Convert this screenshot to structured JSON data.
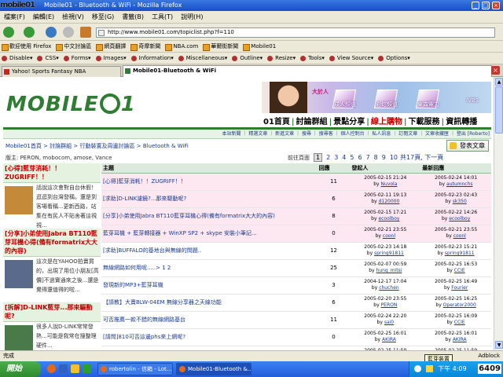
{
  "window": {
    "title": "Mobile01 - Bluetooth & WiFi - Mozilla Firefox",
    "overlay_logo": "mobile01"
  },
  "menu": [
    "檔案(F)",
    "編輯(E)",
    "檢視(V)",
    "移至(G)",
    "書籤(B)",
    "工具(T)",
    "說明(H)"
  ],
  "nav": {
    "url": "http://www.mobile01.com/topiclist.php?f=110"
  },
  "bookmarks": [
    "歡迎使用 Firefox",
    "中文討論區",
    "網頁翻譯",
    "奇摩新聞",
    "NBA.com",
    "華爾街新聞",
    "Mobile01"
  ],
  "devbar": [
    "Disable▾",
    "CSS▾",
    "Forms▾",
    "Images▾",
    "Information▾",
    "Miscellaneous▾",
    "Outline▾",
    "Resize▾",
    "Tools▾",
    "View Source▾",
    "Options▾"
  ],
  "tabs": [
    {
      "label": "Yahoo! Sports Fantasy NBA",
      "active": false
    },
    {
      "label": "Mobile01-Bluetooth & WiFi",
      "active": true
    }
  ],
  "site": {
    "logo_left": "MOBILE",
    "logo_right": "1",
    "banner": [
      "大於人",
      "成人頻道",
      "彩虹頻道",
      "東森電力",
      "IVBS"
    ],
    "main_nav": [
      "01首頁",
      "討論群組",
      "景點分享",
      "線上購物",
      "下載服務",
      "資訊轉播"
    ],
    "sub_nav": "本站新聞 ｜ 精選文章 ｜ 新進文章 ｜ 搜尋 ｜ 搜尋客 ｜ 個人控制台 ｜ 私人訊息 ｜ 訂閱文章 ｜ 文章收藏匣 ｜ 登出 [Roberto]",
    "breadcrumb": "Mobile01首頁 > 討論群組 > 行動裝置及周邊討論區 > Bluetooth & WiFi",
    "post_button": "發表文章",
    "moderators": "版主: PERON, mobocom, amose, Vance",
    "pager_label": "前往頁面",
    "pages": [
      "1",
      "2",
      "3",
      "4",
      "5",
      "6",
      "7",
      "8",
      "9",
      "10"
    ],
    "pager_tail": "共17頁, 下一頁"
  },
  "sidebar": [
    {
      "head": "[心得]藍芽消耗！！ZUGRIFF！！",
      "body": "話說這次會對自台休假！逛逛到台灣發稱，還是到客場看稱...更新西路，站集在有民人不貼舍著這視視...",
      "img_color": "#c48a3a"
    },
    {
      "head": "[分享]小弟使用Jabra BT110藍芽耳機心得(備有formatrix大大的內容)",
      "body": "這次是在YAHOO拍賣買的，出現了用位小朋友[高價]不過實通來之後...還是覺得還值得的啦...",
      "img_color": "#5a6a8a"
    },
    {
      "head": "[拆解]D-LINK藍芽...那來驅動呢?",
      "body": "很多人說D-LINK常常發熱...可能是我常在搜整理硬件...",
      "img_color": "#4a7a4a"
    }
  ],
  "table": {
    "headers": [
      "主題",
      "回應",
      "發起人",
      "最新回應"
    ],
    "rows": [
      {
        "title": "[心得]藍芽消耗！！ZUGRIFF！！",
        "replies": "11",
        "author_time": "2005-02-15 21:24",
        "author": "Nuvola",
        "last_time": "2005-02-24 14:01",
        "last_by": "autumnchs",
        "pink": true
      },
      {
        "title": "[求助]D-LINK濾鏡?...那來驅動呢?",
        "replies": "6",
        "author_time": "2005-02-11 19:13",
        "author": "d120000",
        "last_time": "2005-02-23 02:43",
        "last_by": "sk350",
        "pink": true
      },
      {
        "title": "[分享]小弟使用Jabra BT110藍芽耳機心得(備有formatrix大大的內容)",
        "replies": "8",
        "author_time": "2005-02-15 17:21",
        "author": "ecoolboy",
        "last_time": "2005-02-22 14:26",
        "last_by": "ecoolboy",
        "pink": true
      },
      {
        "title": "藍芽耳機 + 藍芽轉接器 + WinXP SP2 + skype 安裝小筆記...",
        "replies": "0",
        "author_time": "2005-02-21 23:55",
        "author": "coonl",
        "last_time": "2005-02-21 23:55",
        "last_by": "coonl",
        "pink": true
      },
      {
        "title": "[求助]BUFFALO的基地台與無線的問題..",
        "replies": "12",
        "author_time": "2005-02-23 14:18",
        "author": "spring91811",
        "last_time": "2005-02-23 15:21",
        "last_by": "spring91811",
        "pink": false
      },
      {
        "title": "無線網路如何用呢.....> 1 2",
        "replies": "25",
        "author_time": "2005-02-07 00:59",
        "author": "hung_mitsi",
        "last_time": "2005-02-25 16:53",
        "last_by": "CCIE",
        "pink": false
      },
      {
        "title": "發現新的MP3+藍芽耳機",
        "replies": "3",
        "author_time": "2004-12-17 17:04",
        "author": "chuchen",
        "last_time": "2005-02-25 16:49",
        "last_by": "Fourier",
        "pink": false
      },
      {
        "title": "【請教】大賣BLW-04EM 無線分享器之天線功能",
        "replies": "6",
        "author_time": "2005-02-20 23:55",
        "author": "PERON",
        "last_time": "2005-02-25 16:25",
        "last_by": "Operator2000",
        "pink": false
      },
      {
        "title": "可否推薦一款不錯的無線網路基台",
        "replies": "11",
        "author_time": "2005-02-24 22:20",
        "author": "sai0",
        "last_time": "2005-02-25 16:09",
        "last_by": "CCIE",
        "pink": false
      },
      {
        "title": "[請問]810可否這邊phs來上網呢?",
        "replies": "0",
        "author_time": "2005-02-25 16:01",
        "author": "AKIRA",
        "last_time": "2005-02-25 16:01",
        "last_by": "AKIRA",
        "pink": false
      },
      {
        "title": "有沒有人...請教一下...",
        "replies": "0",
        "author_time": "2005-02-25 11:59",
        "author": "",
        "last_time": "2005-02-25 11:59",
        "last_by": "",
        "pink": false
      }
    ]
  },
  "status": {
    "left": "完成",
    "right": "Adblock"
  },
  "taskbar": {
    "start": "開始",
    "tasks": [
      "robertolin - 信箱 - Lot...",
      "Mobile01-Bluetooth &..."
    ],
    "balloon": "藍芽裝置",
    "clock": "下午 4:09",
    "overlay_text": "6409"
  }
}
